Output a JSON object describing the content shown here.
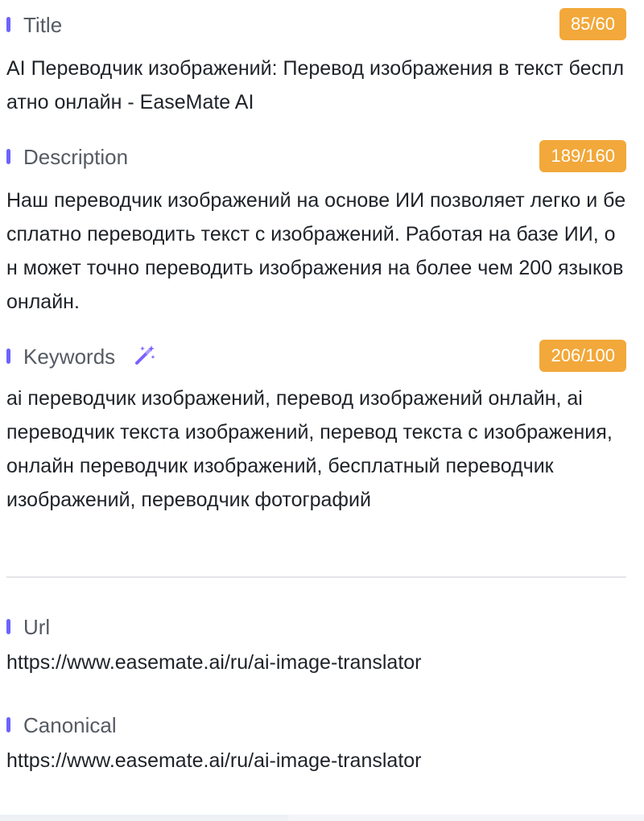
{
  "title_section": {
    "label": "Title",
    "count": "85/60",
    "text": "AI Переводчик изображений: Перевод изображения в текст бесплатно онлайн - EaseMate AI"
  },
  "description_section": {
    "label": "Description",
    "count": "189/160",
    "text": "Наш переводчик изображений на основе ИИ позволяет легко и бесплатно переводить текст с изображений. Работая на базе ИИ, он может точно переводить изображения на более чем 200 языков онлайн."
  },
  "keywords_section": {
    "label": "Keywords",
    "icon": "magic-wand-icon",
    "count": "206/100",
    "text": "ai переводчик изображений, перевод изображений онлайн, ai переводчик текста изображений, перевод текста с изображения, онлайн переводчик изображений, бесплатный переводчик изображений, переводчик фотографий"
  },
  "url_section": {
    "label": "Url",
    "text": "https://www.easemate.ai/ru/ai-image-translator"
  },
  "canonical_section": {
    "label": "Canonical",
    "text": "https://www.easemate.ai/ru/ai-image-translator"
  },
  "colors": {
    "accent": "#6c63ff",
    "badge": "#f2a83a",
    "label": "#555b63",
    "text": "#1f2328"
  }
}
